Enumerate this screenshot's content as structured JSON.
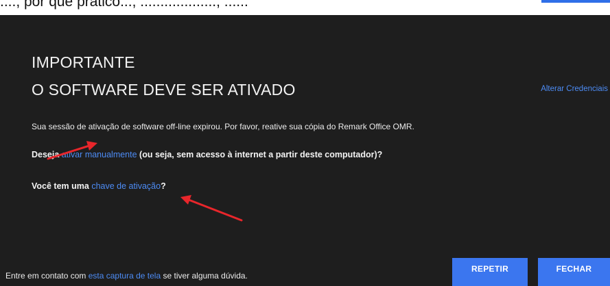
{
  "background_caption": {
    "text": "...., por que prático..., ..................., ......"
  },
  "dialog": {
    "heading_line1": "IMPORTANTE",
    "heading_line2": "O SOFTWARE DEVE SER ATIVADO",
    "change_credentials_link": "Alterar Credenciais",
    "message": "Sua sessão de ativação de software off-line expirou. Por favor, reative sua cópia do Remark Office OMR.",
    "manual_question": {
      "prefix": "Deseja ",
      "link": "ativar manualmente",
      "suffix": " (ou seja, sem acesso à internet a partir deste computador)?"
    },
    "key_question": {
      "prefix": "Você tem uma ",
      "link": "chave de ativação",
      "suffix": "?"
    },
    "footer": {
      "prefix": "Entre em contato com ",
      "link": "esta captura de tela",
      "suffix": " se tiver alguma dúvida."
    },
    "buttons": {
      "retry": "REPETIR",
      "close": "FECHAR"
    }
  },
  "colors": {
    "dialog_background": "#1e1e1e",
    "link": "#4d8cf5",
    "button": "#3b76ef",
    "annotation_arrow": "#e8262b"
  },
  "icons": [
    "arrow-annotation-icon"
  ]
}
